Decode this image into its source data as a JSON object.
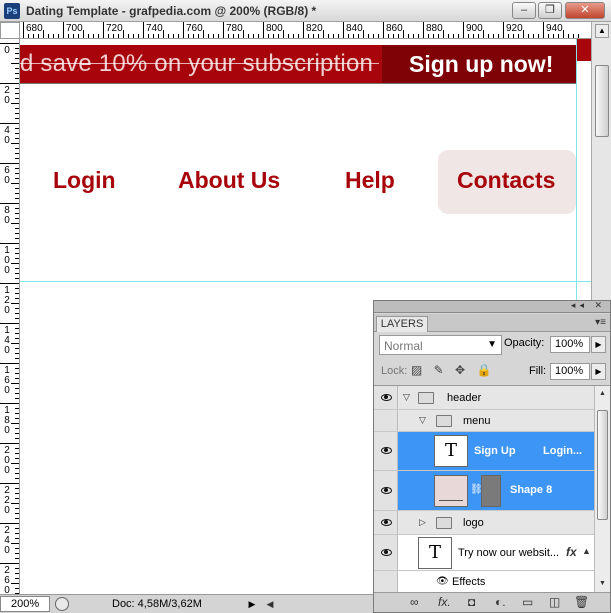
{
  "window": {
    "app_icon": "Ps",
    "title": "Dating Template - grafpedia.com @ 200% (RGB/8) *",
    "minimize": "–",
    "restore": "❐",
    "close": "✕"
  },
  "ruler_top_labels": [
    "680",
    "700",
    "720",
    "740",
    "760",
    "780",
    "800",
    "820",
    "840",
    "860",
    "880",
    "900",
    "920",
    "940"
  ],
  "ruler_left_labels": [
    [
      "0"
    ],
    [
      "2",
      "0"
    ],
    [
      "4",
      "0"
    ],
    [
      "6",
      "0"
    ],
    [
      "8",
      "0"
    ],
    [
      "1",
      "0",
      "0"
    ],
    [
      "1",
      "2",
      "0"
    ],
    [
      "1",
      "4",
      "0"
    ],
    [
      "1",
      "6",
      "0"
    ],
    [
      "1",
      "8",
      "0"
    ],
    [
      "2",
      "0",
      "0"
    ],
    [
      "2",
      "2",
      "0"
    ],
    [
      "2",
      "4",
      "0"
    ],
    [
      "2",
      "6",
      "0"
    ]
  ],
  "canvas": {
    "banner_text": "d save 10% on your subscription",
    "signup_text": "Sign up now!",
    "menu": [
      "Login",
      "About Us",
      "Help",
      "Contacts"
    ]
  },
  "statusbar": {
    "zoom": "200%",
    "doc": "Doc: 4,58M/3,62M",
    "arrow": "▶",
    "scroll_left": "◀"
  },
  "layers_panel": {
    "collapse_icons": "◂◂ ✕",
    "tab": "LAYERS",
    "menu_icon": "▾≡",
    "blend_mode": "Normal",
    "opacity_label": "Opacity:",
    "opacity": "100%",
    "lock_label": "Lock:",
    "lock_icons": "▨ ✎ ✥ 🔒",
    "fill_label": "Fill:",
    "fill": "100%",
    "layers": [
      {
        "name": "header",
        "type": "group",
        "expanded": true
      },
      {
        "name": "menu",
        "type": "group",
        "expanded": true
      },
      {
        "name": "Sign Up",
        "extra": "Login...",
        "type": "text",
        "selected": true
      },
      {
        "name": "Shape 8",
        "type": "shape",
        "selected": true
      },
      {
        "name": "logo",
        "type": "group",
        "expanded": false
      },
      {
        "name": "Try now our websit...",
        "type": "text",
        "fx": "fx"
      },
      {
        "name": "Effects",
        "type": "effects"
      }
    ],
    "bottom_icons": [
      "∞",
      "fx.",
      "◘",
      "◐.",
      "▭",
      "◫",
      "🗑"
    ]
  }
}
